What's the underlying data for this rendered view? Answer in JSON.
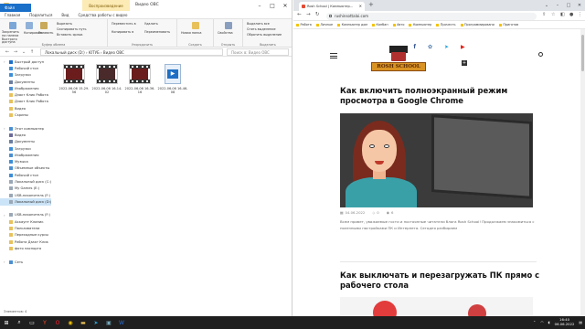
{
  "explorer": {
    "context_tab": "Воспроизведение",
    "window_title": "Видео OBC",
    "ribbon_tabs": [
      "Файл",
      "Главная",
      "Поделиться",
      "Вид",
      "Средства работы с видео"
    ],
    "clipboard": {
      "pin": "Закрепить на панели быстрого доступа",
      "copy": "Копировать",
      "paste": "Вставить",
      "cut": "Вырезать",
      "copy_path": "Скопировать путь",
      "paste_shortcut": "Вставить ярлык",
      "label": "Буфер обмена"
    },
    "organize": {
      "move": "Переместить в",
      "copy_to": "Копировать в",
      "delete": "Удалить",
      "rename": "Переименовать",
      "label": "Упорядочить"
    },
    "new": {
      "folder": "Новая папка",
      "label": "Создать"
    },
    "open": {
      "props": "Свойства",
      "label": "Открыть"
    },
    "select": {
      "all": "Выделить все",
      "none": "Снять выделение",
      "invert": "Обратить выделение",
      "label": "Выделить"
    },
    "breadcrumb": "Локальный диск (D:) › ЮТУБ › Видео OBC",
    "search_placeholder": "Поиск в: Видео OBC",
    "nav_items": [
      {
        "label": "Быстрый доступ",
        "color": "#1a6fc9",
        "chev": "›"
      },
      {
        "label": "Рабочий стол",
        "color": "#3b8ed8"
      },
      {
        "label": "Загрузки",
        "color": "#3b8ed8"
      },
      {
        "label": "Документы",
        "color": "#6a7ea0"
      },
      {
        "label": "Изображения",
        "color": "#4a8fd0"
      },
      {
        "label": "Дзакт Клик Работа",
        "color": "#e8c15a"
      },
      {
        "label": "Дзакт Клик Работа",
        "color": "#e8c15a"
      },
      {
        "label": "Видео",
        "color": "#e8c15a"
      },
      {
        "label": "Скрины",
        "color": "#e8c15a"
      },
      {
        "label": "",
        "color": "#ffffff"
      },
      {
        "label": "Этот компьютер",
        "color": "#4a8fd0",
        "chev": "›"
      },
      {
        "label": "Видео",
        "color": "#6a6a9a"
      },
      {
        "label": "Документы",
        "color": "#6a7ea0"
      },
      {
        "label": "Загрузки",
        "color": "#3b8ed8"
      },
      {
        "label": "Изображения",
        "color": "#4a8fd0"
      },
      {
        "label": "Музыка",
        "color": "#3b8ed8"
      },
      {
        "label": "Объемные объекты",
        "color": "#4a8fd0"
      },
      {
        "label": "Рабочий стол",
        "color": "#3b8ed8"
      },
      {
        "label": "Локальный диск (C:)",
        "color": "#9aa7b5"
      },
      {
        "label": "My Games (E:)",
        "color": "#9aa7b5"
      },
      {
        "label": "USB-накопитель (F:)",
        "color": "#9aa7b5"
      },
      {
        "label": "Локальный диск (D:)",
        "color": "#9aa7b5",
        "selected": true
      },
      {
        "label": "",
        "color": "#ffffff"
      },
      {
        "label": "USB-накопитель (F:)",
        "color": "#9aa7b5",
        "chev": "›"
      },
      {
        "label": "Аккаунт Клиник",
        "color": "#e8c15a"
      },
      {
        "label": "Пользователи",
        "color": "#e8c15a"
      },
      {
        "label": "Переходные курсы",
        "color": "#e8c15a"
      },
      {
        "label": "Работа Дзакт Клик",
        "color": "#e8c15a"
      },
      {
        "label": "фото паспорта",
        "color": "#e8c15a"
      },
      {
        "label": "",
        "color": "#ffffff"
      },
      {
        "label": "Сеть",
        "color": "#4a8fd0",
        "chev": "›"
      }
    ],
    "files": [
      {
        "name": "2022-06-06 15-29-56",
        "type": "video"
      },
      {
        "name": "2022-06-06 16-14-02",
        "type": "video"
      },
      {
        "name": "2022-06-06 16-36-16",
        "type": "video"
      },
      {
        "name": "2022-06-06 16-46-08",
        "type": "player"
      }
    ],
    "status": "Элементов: 4"
  },
  "browser": {
    "tab_title": "Rosh School | Компьютер...",
    "url": "rushinsottalai.com",
    "bookmarks": [
      "Работа",
      "Личные",
      "Компьютер дом",
      "Канбан",
      "Авто",
      "Компьютер",
      "Прочесть",
      "Программировани",
      "Приготов"
    ],
    "site": {
      "logo_text": "ROSH SCHOOL",
      "article1_title": "Как включить полноэкранный режим просмотра в Google Chrome",
      "date": "04.06.2022",
      "comments": "0",
      "views": "6",
      "excerpt": "Всем привет, уважаемые гости и постоянные читатели блога Rosh School! Продолжаем знакомиться с полезными настройками ПК и Интернета. Сегодня разбираем",
      "article2_title": "Как выключать и перезагружать ПК прямо с рабочего стола"
    }
  },
  "taskbar": {
    "time": "16:40",
    "date": "06.06.2022"
  }
}
